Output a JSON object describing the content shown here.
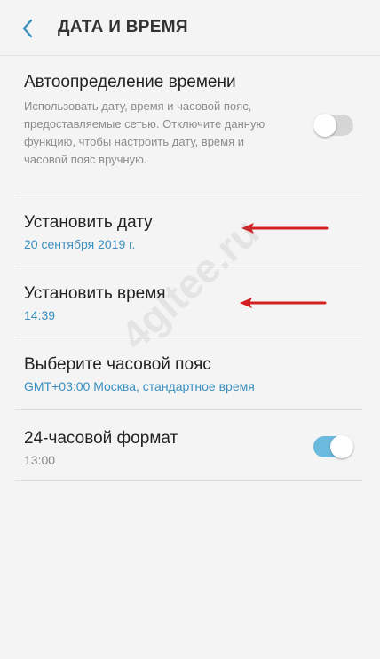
{
  "header": {
    "back_icon": "chevron-left-icon",
    "title": "ДАТА И ВРЕМЯ"
  },
  "settings": {
    "auto_time": {
      "title": "Автоопределение времени",
      "description": "Использовать дату, время и часовой пояс, предоставляемые сетью. Отключите данную функцию, чтобы настроить дату, время и часовой пояс вручную.",
      "enabled": false
    },
    "set_date": {
      "title": "Установить дату",
      "value": "20 сентября 2019 г."
    },
    "set_time": {
      "title": "Установить время",
      "value": "14:39"
    },
    "timezone": {
      "title": "Выберите часовой пояс",
      "value": "GMT+03:00 Москва, стандартное время"
    },
    "format_24h": {
      "title": "24-часовой формат",
      "value": "13:00",
      "enabled": true
    }
  },
  "watermark": "4gltee.ru",
  "colors": {
    "accent": "#3a8fbf",
    "toggle_on": "#6bb9dd",
    "arrow": "#d42020"
  }
}
